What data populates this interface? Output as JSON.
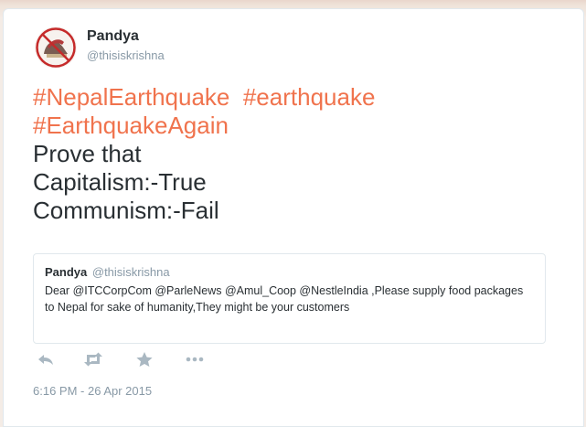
{
  "author": {
    "display_name": "Pandya",
    "handle": "@thisiskrishna"
  },
  "tweet": {
    "hashtags_line1": [
      "#NepalEarthquake",
      "#earthquake"
    ],
    "hashtag_line2": "#EarthquakeAgain",
    "body_lines": [
      "Prove that",
      "Capitalism:-True",
      "Communism:-Fail"
    ]
  },
  "quoted_tweet": {
    "display_name": "Pandya",
    "handle": "@thisiskrishna",
    "text": "Dear @ITCCorpCom @ParleNews @Amul_Coop @NestleIndia ,Please supply food packages to Nepal for sake of humanity,They might be your customers"
  },
  "actions": {
    "icons": [
      "reply-icon",
      "retweet-icon",
      "favorite-icon",
      "more-icon"
    ]
  },
  "timestamp": "6:16 PM - 26 Apr 2015",
  "colors": {
    "hashtag": "#f0734d",
    "text": "#292f33",
    "muted": "#8899a6",
    "border": "#e1e8ed",
    "action_icon": "#aab8c2"
  }
}
